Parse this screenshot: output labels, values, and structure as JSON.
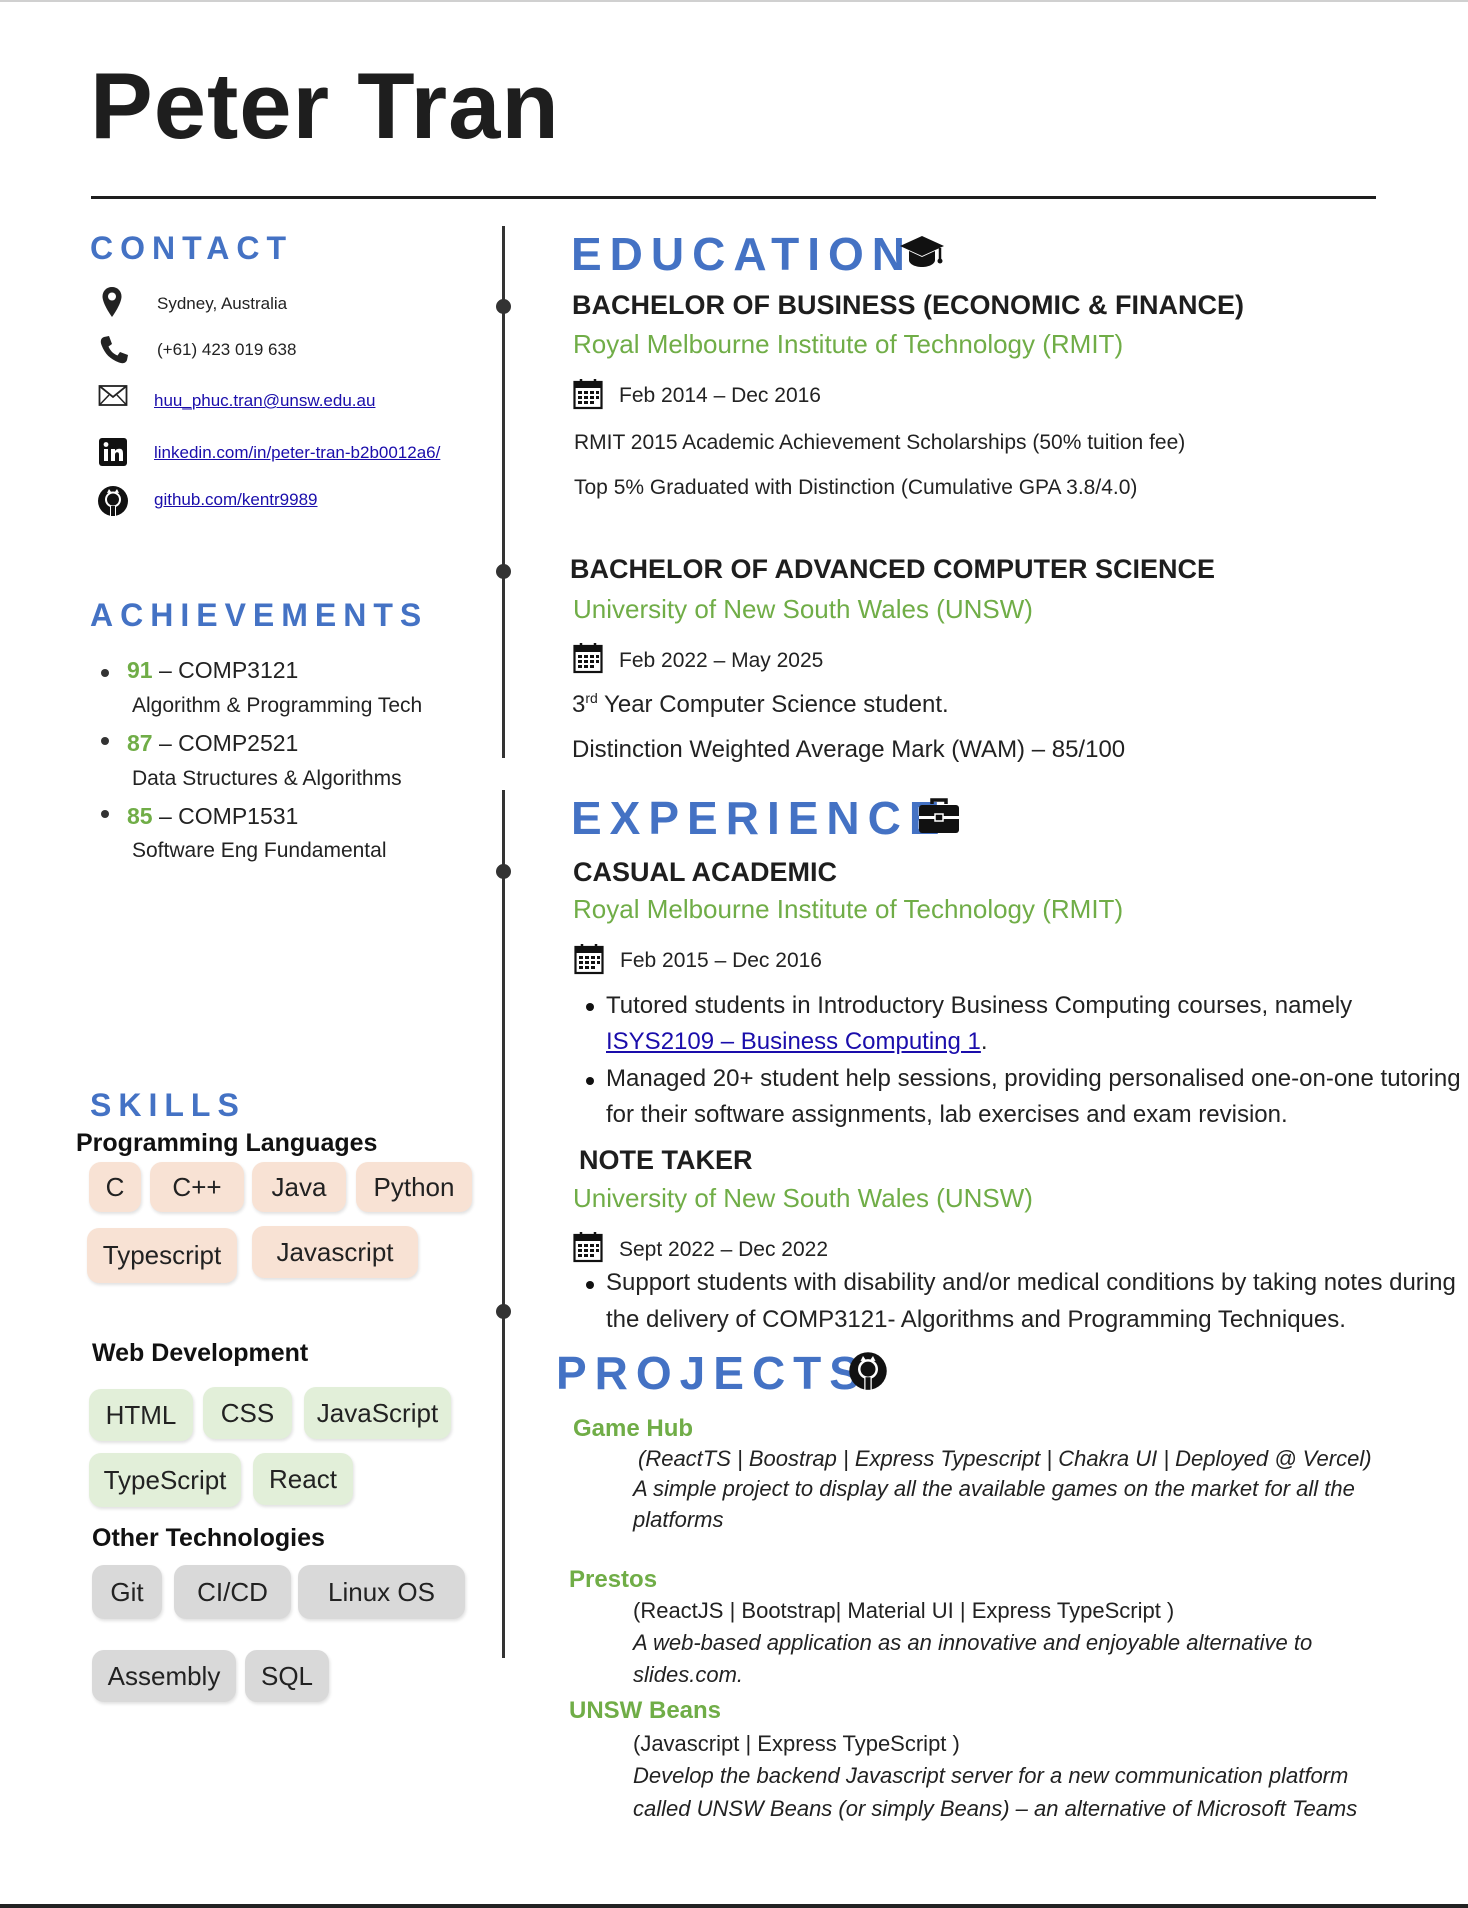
{
  "header": {
    "name": "Peter Tran"
  },
  "contact": {
    "heading": "CONTACT",
    "location": "Sydney, Australia",
    "phone": "(+61) 423 019 638",
    "email": "huu_phuc.tran@unsw.edu.au",
    "linkedin": "linkedin.com/in/peter-tran-b2b0012a6/",
    "github": "github.com/kentr9989"
  },
  "achievements": {
    "heading": "ACHIEVEMENTS",
    "items": [
      {
        "score": "91",
        "sep": " – ",
        "course": "COMP3121",
        "desc": "Algorithm & Programming Tech"
      },
      {
        "score": "87",
        "sep": " – ",
        "course": "COMP2521",
        "desc": "Data Structures & Algorithms"
      },
      {
        "score": "85",
        "sep": " – ",
        "course": "COMP1531",
        "desc": "Software Eng Fundamental"
      }
    ]
  },
  "skills": {
    "heading": "SKILLS",
    "programming": {
      "label": "Programming Languages",
      "items": [
        "C",
        "C++",
        "Java",
        "Python",
        "Typescript",
        "Javascript"
      ]
    },
    "web": {
      "label": "Web Development",
      "items": [
        "HTML",
        "CSS",
        "JavaScript",
        "TypeScript",
        "React"
      ]
    },
    "other": {
      "label": "Other Technologies",
      "items": [
        "Git",
        "CI/CD",
        "Linux OS",
        "Assembly",
        "SQL"
      ]
    }
  },
  "education": {
    "heading": "EDUCATION",
    "entries": [
      {
        "degree": "BACHELOR OF BUSINESS (ECONOMIC & FINANCE)",
        "institution": "Royal Melbourne Institute of Technology (RMIT)",
        "dates": "Feb 2014 – Dec 2016",
        "lines": [
          "RMIT 2015 Academic Achievement Scholarships (50% tuition fee)",
          "Top 5% Graduated with Distinction (Cumulative GPA 3.8/4.0)"
        ]
      },
      {
        "degree": "BACHELOR OF ADVANCED COMPUTER SCIENCE",
        "institution": "University of New South Wales (UNSW)",
        "dates": "Feb 2022 – May 2025",
        "year_num": "3",
        "year_sup": "rd",
        "year_rest": " Year Computer Science student.",
        "wam": "Distinction Weighted Average Mark (WAM) – 85/100"
      }
    ]
  },
  "experience": {
    "heading": "EXPERIENCE",
    "entries": [
      {
        "title": "CASUAL ACADEMIC",
        "institution": "Royal Melbourne Institute of Technology (RMIT)",
        "dates": "Feb 2015 – Dec 2016",
        "b1_line1": "Tutored students in Introductory Business Computing courses, namely",
        "b1_link": "ISYS2109 – Business Computing 1",
        "b1_end": ".",
        "b2_line1": "Managed 20+ student help sessions, providing personalised one-on-one tutoring",
        "b2_line2": "for their software assignments, lab exercises and exam revision."
      },
      {
        "title": "NOTE TAKER",
        "institution": "University of New South Wales (UNSW)",
        "dates": "Sept 2022 – Dec 2022",
        "b1_line1": "Support students with disability and/or medical conditions by taking notes during",
        "b1_line2": "the delivery of COMP3121- Algorithms and Programming Techniques."
      }
    ]
  },
  "projects": {
    "heading": "PROJECTS",
    "items": [
      {
        "title": "Game Hub",
        "tech": "(ReactTS | Boostrap | Express Typescript | Chakra UI | Deployed @ Vercel)",
        "desc1": "A simple project to display all the available games on the market for all the",
        "desc2": "platforms"
      },
      {
        "title": "Prestos",
        "tech": "(ReactJS | Bootstrap| Material UI | Express TypeScript )",
        "desc1": "A web-based application as an innovative and enjoyable alternative to",
        "desc2": "slides.com."
      },
      {
        "title": "UNSW Beans",
        "tech": "(Javascript | Express TypeScript )",
        "desc1": "Develop the backend Javascript server for a new communication platform",
        "desc2": "called UNSW Beans (or simply Beans) – an alternative of Microsoft Teams"
      }
    ]
  },
  "colors": {
    "accent_blue": "#4472c4",
    "accent_green": "#70ad47",
    "chip_peach": "#f8e2d4",
    "chip_green": "#e2efd9",
    "chip_grey": "#d9d9d9"
  },
  "icons": [
    "location-pin-icon",
    "phone-icon",
    "envelope-icon",
    "linkedin-icon",
    "github-icon",
    "graduation-cap-icon",
    "briefcase-icon",
    "calendar-icon"
  ]
}
